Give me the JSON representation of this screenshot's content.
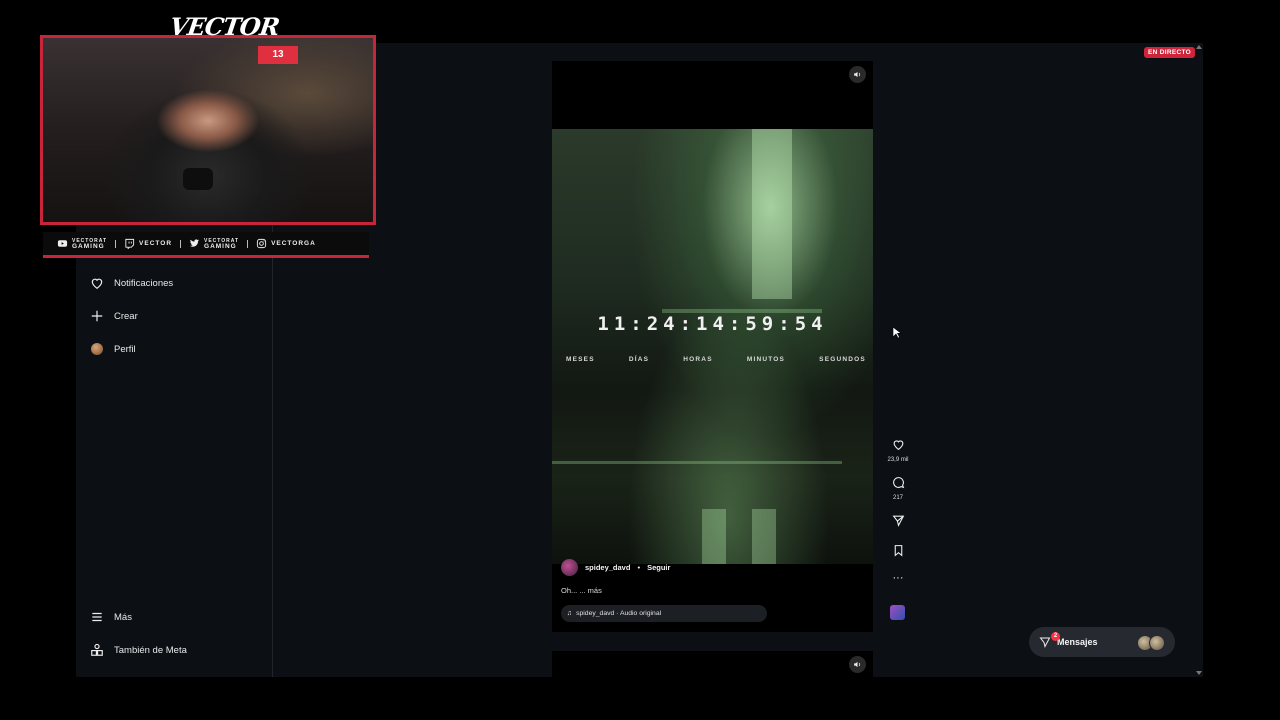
{
  "overlay": {
    "streamer_logo": "VECTOR",
    "socials": [
      {
        "line1": "VECTORAT",
        "line2": "GAMING"
      },
      {
        "label": "VECTOR"
      },
      {
        "line1": "VECTORAT",
        "line2": "GAMING"
      },
      {
        "label": "VECTORGA"
      }
    ],
    "cam_sign": "13"
  },
  "live_badge": "EN DIRECTO",
  "sidebar": {
    "items": [
      {
        "label": "Notificaciones",
        "icon": "heart-icon"
      },
      {
        "label": "Crear",
        "icon": "plus-icon"
      },
      {
        "label": "Perfil",
        "icon": "avatar"
      },
      {
        "label": "Más",
        "icon": "menu-icon"
      },
      {
        "label": "También de Meta",
        "icon": "meta-apps-icon"
      }
    ]
  },
  "reel": {
    "countdown": "11:24:14:59:54",
    "countdown_labels": [
      "MESES",
      "DÍAS",
      "HORAS",
      "MINUTOS",
      "SEGUNDOS"
    ],
    "author": "spidey_davd",
    "follow_label": "Seguir",
    "caption": "Oh... ... más",
    "audio": "spidey_davd · Audio original"
  },
  "actions": {
    "likes": "23,9 mil",
    "comments": "217"
  },
  "messages": {
    "label": "Mensajes",
    "badge": "2"
  },
  "colors": {
    "accent_red": "#c8253a",
    "live_red": "#d0243a",
    "page_bg": "#0c1014"
  }
}
